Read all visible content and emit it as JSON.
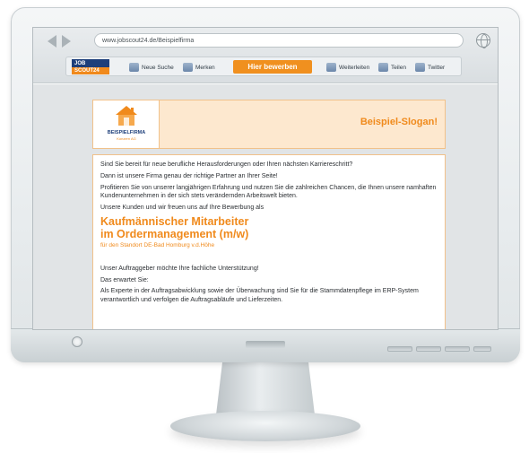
{
  "browser": {
    "url": "www.jobscout24.de/Beispielfirma"
  },
  "site_toolbar": {
    "brand_line1": "JOB",
    "brand_line2": "SCOUT24",
    "new_search": "Neue Suche",
    "bookmark": "Merken",
    "apply": "Hier bewerben",
    "forward": "Weiterleiten",
    "share": "Teilen",
    "twitter": "Twitter"
  },
  "company": {
    "logo_name": "BEISPIELFIRMA",
    "logo_sub": "Konzern AG",
    "slogan": "Beispiel-Slogan!"
  },
  "ad": {
    "intro_1": "Sind Sie bereit für neue berufliche Herausforderungen oder Ihren nächsten Karriereschritt?",
    "intro_2": "Dann ist unsere Firma genau der richtige Partner an Ihrer Seite!",
    "intro_3": "Profitieren Sie von unserer langjährigen Erfahrung und nutzen Sie die zahlreichen Chancen, die Ihnen unsere namhaften Kundenunternehmen in der sich stets verändernden Arbeitswelt bieten.",
    "intro_4": "Unsere Kunden und wir freuen uns auf Ihre Bewerbung als",
    "title_line1": "Kaufmännischer Mitarbeiter",
    "title_line2": "im Ordermanagement (m/w)",
    "location": "für den Standort DE-Bad Homburg v.d.Höhe",
    "support": "Unser Auftraggeber möchte Ihre fachliche Unterstützung!",
    "expect": "Das erwartet Sie:",
    "duties": "Als Experte in der Auftragsabwicklung sowie der Überwachung sind Sie für die Stammdatenpflege im ERP-System verantwortlich und verfolgen die Auftragsabläufe und Lieferzeiten."
  },
  "colors": {
    "accent": "#f08a1c",
    "brand_blue": "#1d3f7a"
  }
}
